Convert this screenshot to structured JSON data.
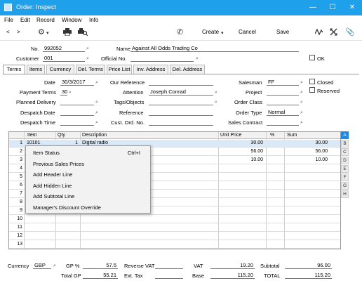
{
  "window": {
    "title": "Order: Inspect",
    "minimize": "—",
    "maximize": "☐",
    "close": "✕"
  },
  "menu": [
    "File",
    "Edit",
    "Record",
    "Window",
    "Info"
  ],
  "toolbar": {
    "back": "<",
    "forward": ">",
    "create": "Create",
    "cancel": "Cancel",
    "save": "Save"
  },
  "header": {
    "no_label": "No.",
    "no_value": "992052",
    "name_label": "Name",
    "name_value": "Against All Odds Trading Co",
    "customer_label": "Customer",
    "customer_value": "001",
    "official_label": "Official No.",
    "official_value": "",
    "ok_label": "OK"
  },
  "tabs": [
    "Terms",
    "Items",
    "Currency",
    "Del. Terms",
    "Price List",
    "Inv. Address",
    "Del. Address"
  ],
  "terms": {
    "date_label": "Date",
    "date_value": "30/3/2017",
    "our_ref_label": "Our Reference",
    "our_ref_value": "",
    "salesman_label": "Salesman",
    "salesman_value": "FF",
    "closed_label": "Closed",
    "payment_terms_label": "Payment Terms",
    "payment_terms_value": "30",
    "attention_label": "Attention",
    "attention_value": "Joseph Conrad",
    "project_label": "Project",
    "project_value": "",
    "reserved_label": "Reserved",
    "planned_delivery_label": "Planned Delivery",
    "planned_delivery_value": "",
    "tags_label": "Tags/Objects",
    "tags_value": "",
    "order_class_label": "Order Class",
    "order_class_value": "",
    "despatch_date_label": "Despatch Date",
    "despatch_date_value": "",
    "reference_label": "Reference",
    "reference_value": "",
    "order_type_label": "Order Type",
    "order_type_value": "Normal",
    "despatch_time_label": "Despatch Time",
    "despatch_time_value": "",
    "cust_ord_label": "Cust. Ord. No.",
    "cust_ord_value": "",
    "sales_contract_label": "Sales Contract",
    "sales_contract_value": ""
  },
  "matrix": {
    "columns": [
      "Item",
      "Qty",
      "Description",
      "Unit Price",
      "%",
      "Sum"
    ],
    "rows": [
      {
        "n": "1",
        "item": "10101",
        "qty": "1",
        "desc": "Digital radio",
        "price": "30.00",
        "pct": "",
        "sum": "30.00"
      },
      {
        "n": "2",
        "item": "",
        "qty": "",
        "desc": "",
        "price": "56.00",
        "pct": "",
        "sum": "56.00"
      },
      {
        "n": "3",
        "item": "",
        "qty": "",
        "desc": "",
        "price": "10.00",
        "pct": "",
        "sum": "10.00"
      },
      {
        "n": "4",
        "item": "",
        "qty": "",
        "desc": "",
        "price": "",
        "pct": "",
        "sum": ""
      },
      {
        "n": "5",
        "item": "",
        "qty": "",
        "desc": "",
        "price": "",
        "pct": "",
        "sum": ""
      },
      {
        "n": "6",
        "item": "",
        "qty": "",
        "desc": "",
        "price": "",
        "pct": "",
        "sum": ""
      },
      {
        "n": "7",
        "item": "",
        "qty": "",
        "desc": "",
        "price": "",
        "pct": "",
        "sum": ""
      },
      {
        "n": "8",
        "item": "",
        "qty": "",
        "desc": "",
        "price": "",
        "pct": "",
        "sum": ""
      },
      {
        "n": "9",
        "item": "",
        "qty": "",
        "desc": "",
        "price": "",
        "pct": "",
        "sum": ""
      },
      {
        "n": "10",
        "item": "",
        "qty": "",
        "desc": "",
        "price": "",
        "pct": "",
        "sum": ""
      },
      {
        "n": "11",
        "item": "",
        "qty": "",
        "desc": "",
        "price": "",
        "pct": "",
        "sum": ""
      },
      {
        "n": "12",
        "item": "",
        "qty": "",
        "desc": "",
        "price": "",
        "pct": "",
        "sum": ""
      },
      {
        "n": "13",
        "item": "",
        "qty": "",
        "desc": "",
        "price": "",
        "pct": "",
        "sum": ""
      }
    ],
    "row_letters": [
      "A",
      "B",
      "C",
      "D",
      "E",
      "F",
      "G",
      "H"
    ]
  },
  "context_menu": [
    {
      "label": "Item Status",
      "shortcut": "Ctrl+I"
    },
    {
      "label": "Previous Sales Prices",
      "shortcut": ""
    },
    {
      "label": "Add Header Line",
      "shortcut": ""
    },
    {
      "label": "Add Hidden Line",
      "shortcut": ""
    },
    {
      "label": "Add Subtotal Line",
      "shortcut": ""
    },
    {
      "label": "Manager's Discount Override",
      "shortcut": ""
    }
  ],
  "footer": {
    "currency_label": "Currency",
    "currency_value": "GBP",
    "gp_pct_label": "GP %",
    "gp_pct_value": "57.5",
    "reverse_vat_label": "Reverse VAT",
    "reverse_vat_value": "",
    "vat_label": "VAT",
    "vat_value": "19.20",
    "subtotal_label": "Subtotal",
    "subtotal_value": "96.00",
    "total_gp_label": "Total GP",
    "total_gp_value": "55.21",
    "ext_tax_label": "Ext. Tax",
    "ext_tax_value": "",
    "base_label": "Base",
    "base_value": "115.20",
    "total_label": "TOTAL",
    "total_value": "115.20"
  },
  "colors": {
    "titlebar": "#1ea0ea",
    "selection": "#dbe8f6",
    "active_letter": "#1e88e5"
  }
}
